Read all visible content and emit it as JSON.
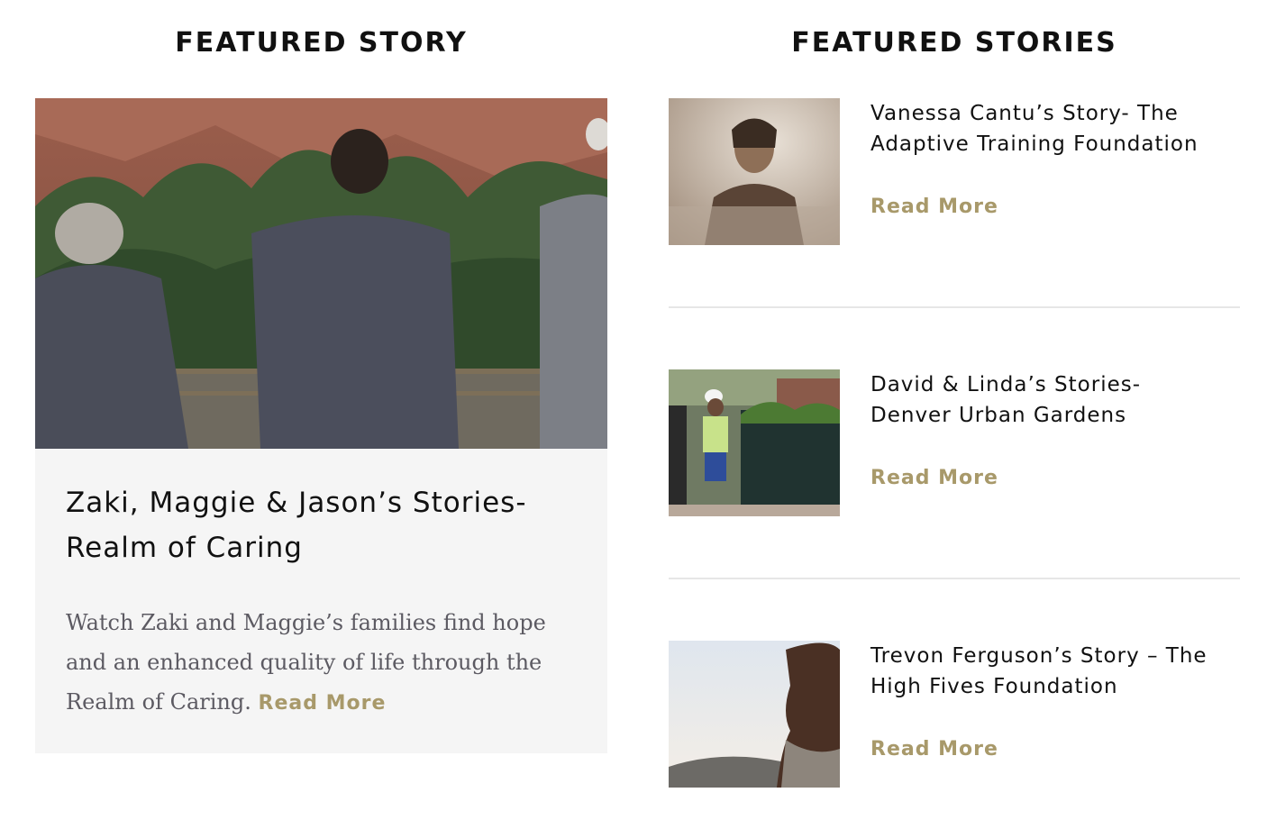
{
  "left_section": {
    "heading": "FEATURED STORY",
    "feature": {
      "image_alt": "people-walking-in-red-rock-park-photo",
      "title_line1": "Zaki, Maggie & Jason’s Stories-",
      "title_line2": "Realm of Caring",
      "description": "Watch Zaki and Maggie’s families find hope and an enhanced quality of life through the Realm of Caring.",
      "read_more": "Read More"
    }
  },
  "right_section": {
    "heading": "FEATURED STORIES",
    "stories": [
      {
        "title_line1": "Vanessa Cantu’s Story- The",
        "title_line2": "Adaptive Training Foundation",
        "read_more": "Read More",
        "thumb": "woman-in-gym-photo"
      },
      {
        "title_line1": "David & Linda’s Stories-",
        "title_line2": "Denver Urban Gardens",
        "read_more": "Read More",
        "thumb": "community-garden-gate-photo"
      },
      {
        "title_line1": "Trevon Ferguson’s Story – The",
        "title_line2": "High Fives Foundation",
        "read_more": "Read More",
        "thumb": "man-portrait-sunset-photo"
      }
    ]
  },
  "colors": {
    "accent": "#a8996a",
    "card_bg": "#f5f5f5",
    "body_text": "#5c5a62",
    "divider": "#e6e6e6"
  }
}
